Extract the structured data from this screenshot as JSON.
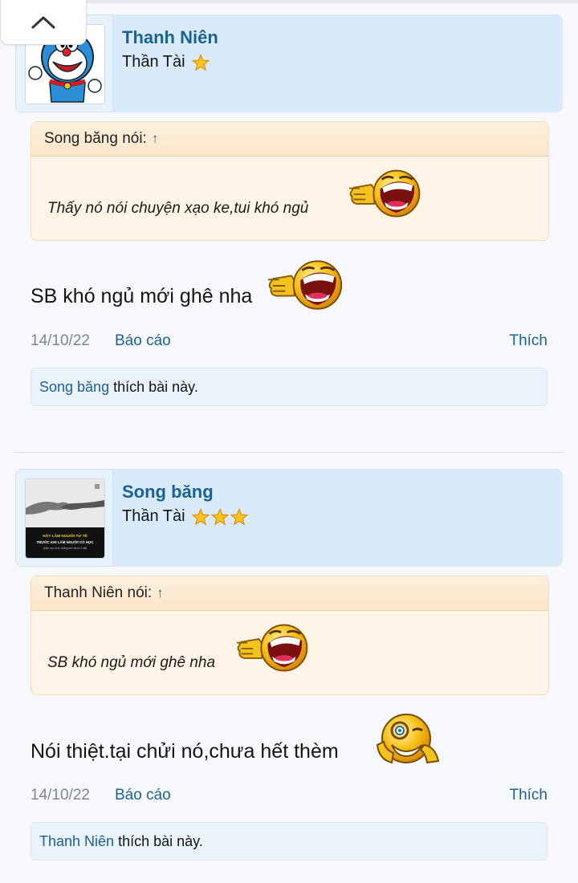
{
  "ui": {
    "scroll_top_icon": "chevron-up-icon",
    "star_icon": "star-icon",
    "emote_icon": "laughing-pointing-smiley-icon",
    "wink_icon": "winking-ok-smiley-icon"
  },
  "posts": [
    {
      "author": {
        "name": "Thanh Niên",
        "title": "Thần Tài",
        "stars": 1
      },
      "quote": {
        "author_label": "Song băng nói:",
        "arrow": "↑",
        "text": "Thấy nó nói chuyện xạo ke,tui khó ngủ"
      },
      "message": "SB khó ngủ mới ghê nha",
      "date": "14/10/22",
      "report_label": "Báo cáo",
      "like_label": "Thích",
      "likes": {
        "user": "Song băng",
        "text": "thích bài này."
      }
    },
    {
      "author": {
        "name": "Song băng",
        "title": "Thần Tài",
        "stars": 3,
        "avatar_caption_line1": "HÃY LÀM NGƯỜI TỬ TẾ",
        "avatar_caption_line2": "TRƯỚC KHI LÀM NGƯỜI CÓ HỌC",
        "avatar_caption_line3": "(Điều học là dù chẳng nên được ít đất)"
      },
      "quote": {
        "author_label": "Thanh Niên nói:",
        "arrow": "↑",
        "text": "SB khó ngủ mới ghê nha"
      },
      "message": "Nói thiệt.tại chửi nó,chưa hết thèm",
      "date": "14/10/22",
      "report_label": "Báo cáo",
      "like_label": "Thích",
      "likes": {
        "user": "Thanh Niên",
        "text": "thích bài này."
      }
    }
  ]
}
